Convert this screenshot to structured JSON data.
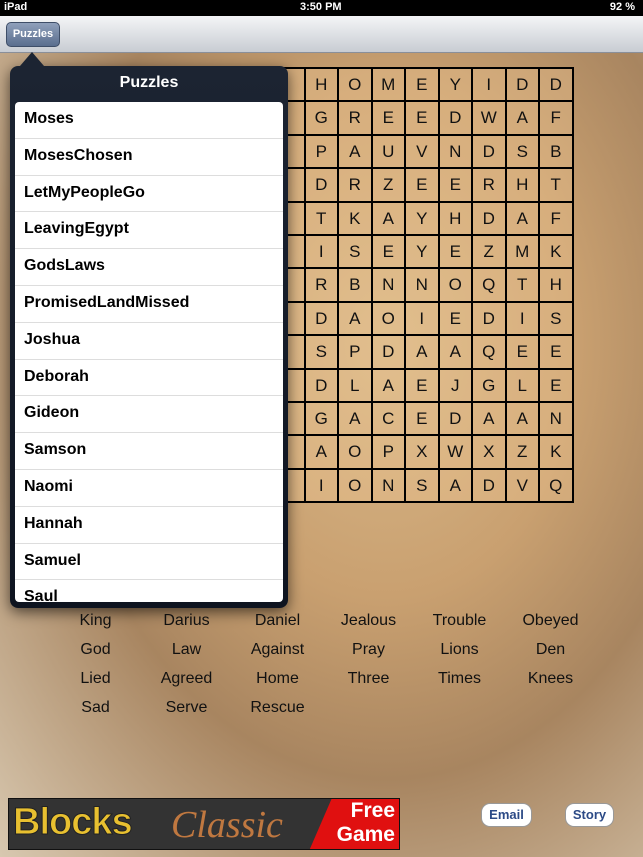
{
  "status": {
    "device": "iPad",
    "time": "3:50 PM",
    "battery": "92 %"
  },
  "nav": {
    "puzzles_button": "Puzzles"
  },
  "grid": [
    [
      "H",
      "O",
      "M",
      "E",
      "Y",
      "I",
      "D",
      "D"
    ],
    [
      "G",
      "R",
      "E",
      "E",
      "D",
      "W",
      "A",
      "F"
    ],
    [
      "P",
      "A",
      "U",
      "V",
      "N",
      "D",
      "S",
      "B"
    ],
    [
      "D",
      "R",
      "Z",
      "E",
      "E",
      "R",
      "H",
      "T"
    ],
    [
      "T",
      "K",
      "A",
      "Y",
      "H",
      "D",
      "A",
      "F"
    ],
    [
      "I",
      "S",
      "E",
      "Y",
      "E",
      "Z",
      "M",
      "K"
    ],
    [
      "R",
      "B",
      "N",
      "N",
      "O",
      "Q",
      "T",
      "H"
    ],
    [
      "D",
      "A",
      "O",
      "I",
      "E",
      "D",
      "I",
      "S"
    ],
    [
      "S",
      "P",
      "D",
      "A",
      "A",
      "Q",
      "E",
      "E"
    ],
    [
      "D",
      "L",
      "A",
      "E",
      "J",
      "G",
      "L",
      "E"
    ],
    [
      "G",
      "A",
      "C",
      "E",
      "D",
      "A",
      "A",
      "N"
    ],
    [
      "A",
      "O",
      "P",
      "X",
      "W",
      "X",
      "Z",
      "K"
    ],
    [
      "I",
      "O",
      "N",
      "S",
      "A",
      "D",
      "V",
      "Q"
    ]
  ],
  "popover": {
    "title": "Puzzles",
    "items": [
      "Moses",
      "MosesChosen",
      "LetMyPeopleGo",
      "LeavingEgypt",
      "GodsLaws",
      "PromisedLandMissed",
      "Joshua",
      "Deborah",
      "Gideon",
      "Samson",
      "Naomi",
      "Hannah",
      "Samuel",
      "Saul"
    ]
  },
  "words": [
    "King",
    "Darius",
    "Daniel",
    "Jealous",
    "Trouble",
    "Obeyed",
    "God",
    "Law",
    "Against",
    "Pray",
    "Lions",
    "Den",
    "Lied",
    "Agreed",
    "Home",
    "Three",
    "Times",
    "Knees",
    "Sad",
    "Serve",
    "Rescue"
  ],
  "ad": {
    "text1": "Blocks",
    "text2": "Classic",
    "text3": "Free",
    "text4": "Game"
  },
  "buttons": {
    "email": "Email",
    "story": "Story"
  }
}
